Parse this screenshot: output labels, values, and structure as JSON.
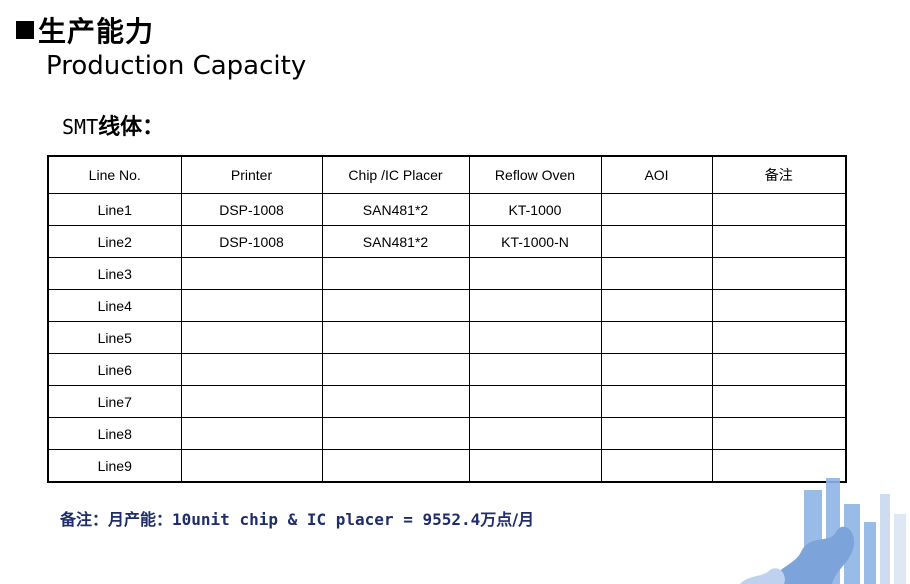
{
  "heading": {
    "title_cn": "生产能力",
    "title_en": "Production Capacity"
  },
  "section": {
    "prefix": "SMT",
    "label_cn": "线体："
  },
  "table": {
    "columns": [
      "Line No.",
      "Printer",
      "Chip /IC Placer",
      "Reflow Oven",
      "AOI",
      "备注"
    ],
    "rows": [
      [
        "Line1",
        "DSP-1008",
        "SAN481*2",
        "KT-1000",
        "",
        ""
      ],
      [
        "Line2",
        "DSP-1008",
        "SAN481*2",
        "KT-1000-N",
        "",
        ""
      ],
      [
        "Line3",
        "",
        "",
        "",
        "",
        ""
      ],
      [
        "Line4",
        "",
        "",
        "",
        "",
        ""
      ],
      [
        "Line5",
        "",
        "",
        "",
        "",
        ""
      ],
      [
        "Line6",
        "",
        "",
        "",
        "",
        ""
      ],
      [
        "Line7",
        "",
        "",
        "",
        "",
        ""
      ],
      [
        "Line8",
        "",
        "",
        "",
        "",
        ""
      ],
      [
        "Line9",
        "",
        "",
        "",
        "",
        ""
      ]
    ]
  },
  "footer": {
    "label_cn": "备注：月产能：",
    "formula": "10unit chip & IC placer = 9552.4",
    "unit_cn": "万点/月"
  },
  "colors": {
    "footer_text": "#1f2d6b",
    "decor_blue": "#8fb4e6"
  }
}
